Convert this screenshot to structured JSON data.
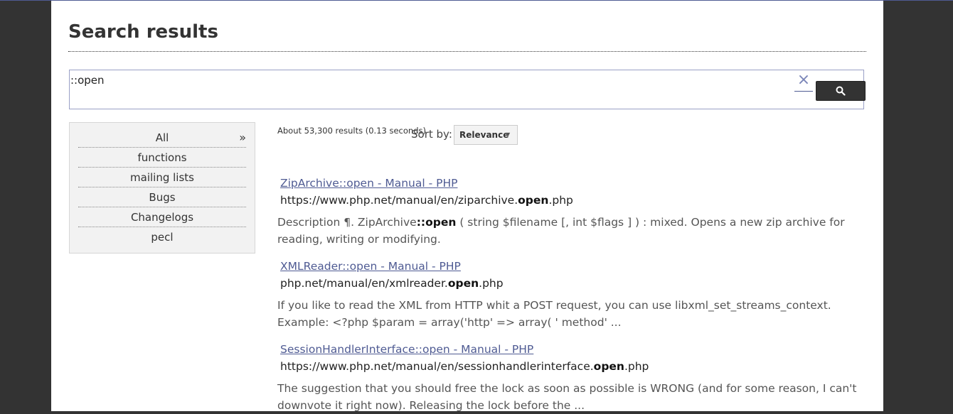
{
  "page": {
    "title": "Search results"
  },
  "search": {
    "query": "::open",
    "clear_label": "×"
  },
  "facets": [
    {
      "label": "All",
      "arrow": "»"
    },
    {
      "label": "functions"
    },
    {
      "label": "mailing lists"
    },
    {
      "label": "Bugs"
    },
    {
      "label": "Changelogs"
    },
    {
      "label": "pecl"
    }
  ],
  "results_info": {
    "stats": "About 53,300 results (0.13 seconds)",
    "sort_label": "Sort by:",
    "sort_value": "Relevance"
  },
  "results": [
    {
      "title": "ZipArchive::open - Manual - PHP",
      "url_pre": "https://www.php.net/manual/en/ziparchive.",
      "url_bold": "open",
      "url_post": ".php",
      "snip_pre": "Description ¶. ZipArchive",
      "snip_bold": "::open",
      "snip_post": " ( string $filename [, int $flags ] ) : mixed. Opens a new zip archive for reading, writing or modifying."
    },
    {
      "title": "XMLReader::open - Manual - PHP",
      "url_pre": "php.net/manual/en/xmlreader.",
      "url_bold": "open",
      "url_post": ".php",
      "snip_pre": "If you like to read the XML from HTTP whit a POST request, you can use libxml_set_streams_context. Example: <?php $param = array('http' => array( ' method' ...",
      "snip_bold": "",
      "snip_post": ""
    },
    {
      "title": "SessionHandlerInterface::open - Manual - PHP",
      "url_pre": "https://www.php.net/manual/en/sessionhandlerinterface.",
      "url_bold": "open",
      "url_post": ".php",
      "snip_pre": "The suggestion that you should free the lock as soon as possible is WRONG (and for some reason, I can't downvote it right now). Releasing the lock before the ...",
      "snip_bold": "",
      "snip_post": ""
    }
  ]
}
